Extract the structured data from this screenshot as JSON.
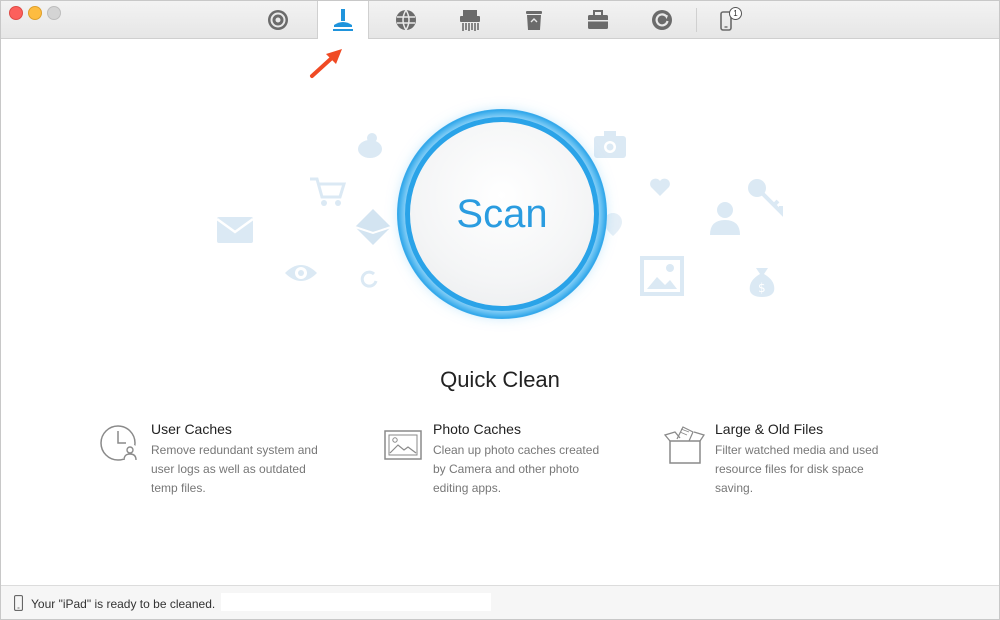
{
  "toolbar": {
    "tabs": [
      {
        "name": "airbackup-icon"
      },
      {
        "name": "cleaner-icon",
        "active": true
      },
      {
        "name": "internet-icon"
      },
      {
        "name": "shredder-icon"
      },
      {
        "name": "trash-icon"
      },
      {
        "name": "toolkit-icon"
      },
      {
        "name": "sync-icon"
      },
      {
        "name": "device-icon",
        "badge": "1"
      }
    ]
  },
  "scan": {
    "label": "Scan"
  },
  "main": {
    "title": "Quick Clean",
    "features": [
      {
        "name": "User Caches",
        "desc": "Remove redundant system and user logs as well as outdated temp files.",
        "icon": "user-caches-icon"
      },
      {
        "name": "Photo Caches",
        "desc": "Clean up photo caches created by Camera and other photo editing apps.",
        "icon": "photo-caches-icon"
      },
      {
        "name": "Large & Old Files",
        "desc": "Filter watched media and used resource files for disk space saving.",
        "icon": "large-old-files-icon"
      }
    ]
  },
  "status": {
    "text": "Your \"iPad\" is ready to be cleaned."
  },
  "colors": {
    "accent": "#2aa3e8",
    "arrow": "#f04a24"
  }
}
